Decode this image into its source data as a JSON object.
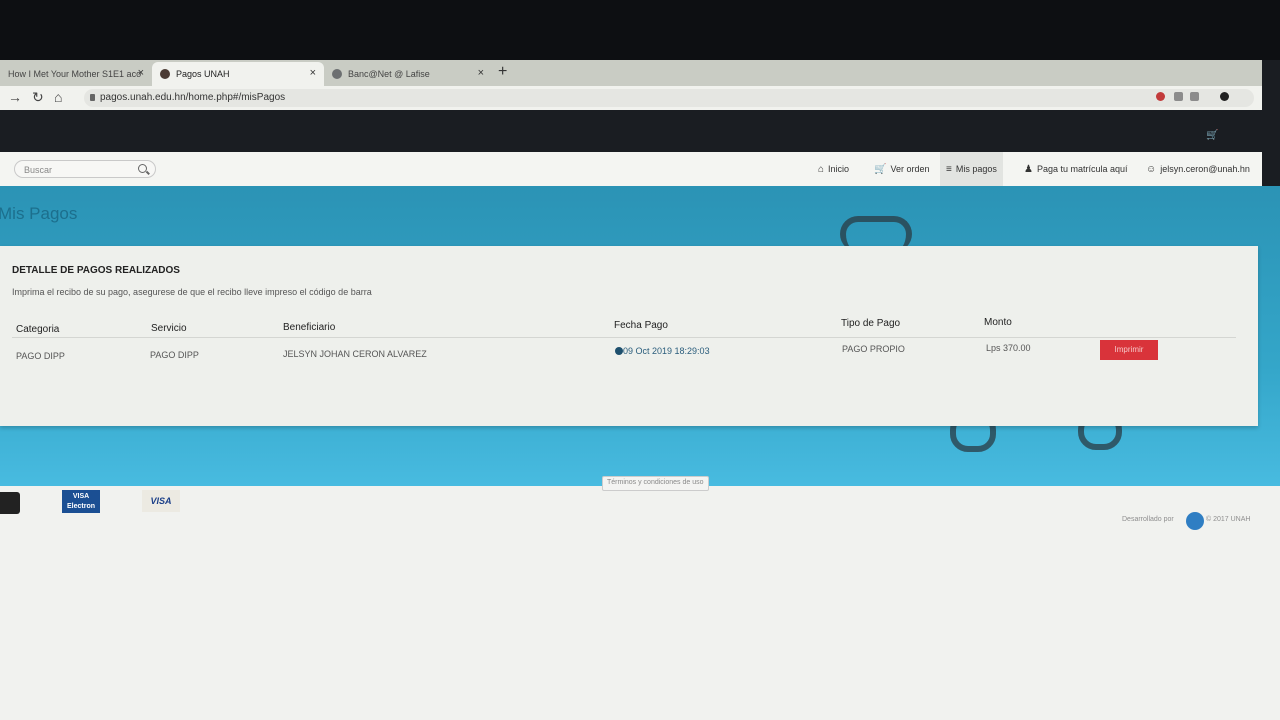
{
  "browser": {
    "tabs": [
      {
        "title": "How I Met Your Mother S1E1 aco",
        "active": false
      },
      {
        "title": "Pagos UNAH",
        "active": true
      },
      {
        "title": "Banc@Net @ Lafise",
        "active": false
      }
    ],
    "new_tab": "+",
    "url": "pagos.unah.edu.hn/home.php#/misPagos"
  },
  "navbar": {
    "search_placeholder": "Buscar",
    "items": [
      {
        "label": "Inicio",
        "icon": "home-icon"
      },
      {
        "label": "Ver orden",
        "icon": "cart-icon"
      },
      {
        "label": "Mis pagos",
        "icon": "list-icon"
      },
      {
        "label": "Paga tu matrícula aquí",
        "icon": "mascot-icon"
      },
      {
        "label": "jelsyn.ceron@unah.hn",
        "icon": "user-icon"
      }
    ]
  },
  "page": {
    "title": "Mis Pagos"
  },
  "payments": {
    "heading": "DETALLE DE PAGOS REALIZADOS",
    "subtitle": "Imprima el recibo de su pago, asegurese de que el recibo lleve impreso el código de barra",
    "columns": [
      "Categoria",
      "Servicio",
      "Beneficiario",
      "Fecha Pago",
      "Tipo de Pago",
      "Monto"
    ],
    "rows": [
      {
        "categoria": "PAGO DIPP",
        "servicio": "PAGO DIPP",
        "beneficiario": "JELSYN JOHAN CERON ALVAREZ",
        "fecha": "09 Oct 2019 18:29:03",
        "tipo": "PAGO PROPIO",
        "monto": "Lps 370.00",
        "action": "Imprimir"
      }
    ]
  },
  "footer": {
    "terms": "Términos y condiciones de uso",
    "cards": [
      "VISA Electron",
      "VISA"
    ],
    "developed_by": "Desarrollado por",
    "copyright": "© 2017 UNAH"
  },
  "colors": {
    "hero": "#34a6c9",
    "print_button": "#d9333a"
  }
}
